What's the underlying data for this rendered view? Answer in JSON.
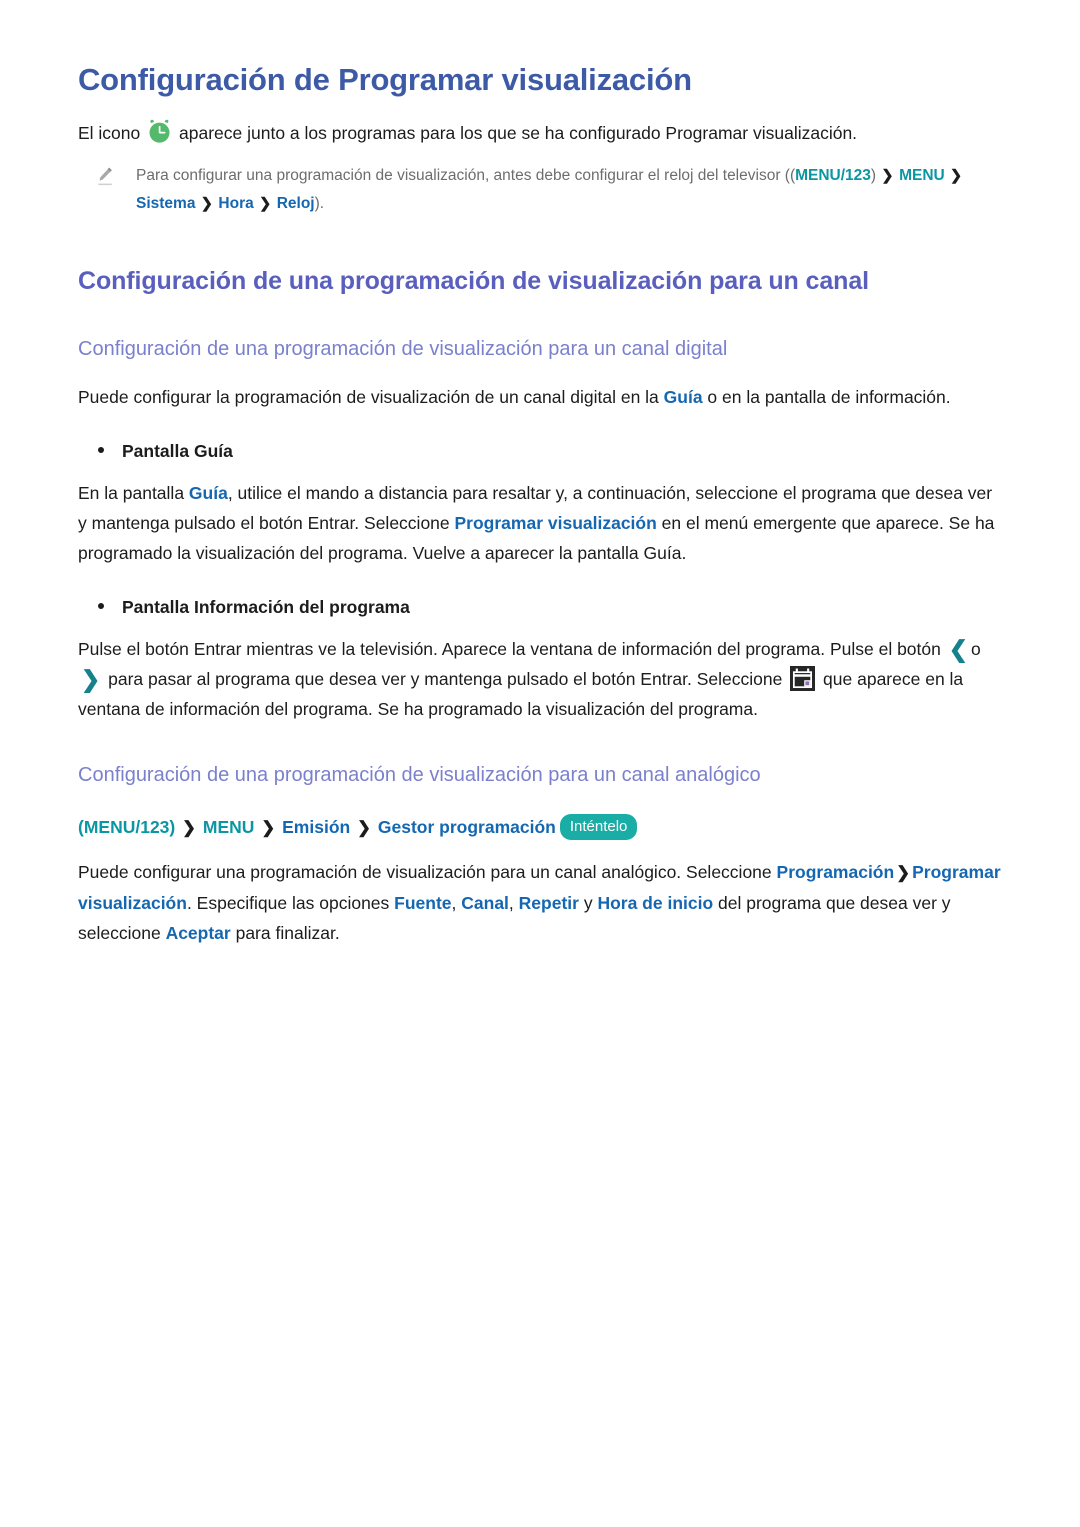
{
  "document": {
    "title": "Configuración de Programar visualización",
    "intro": {
      "before_icon": "El icono",
      "icon": "alarm-clock-icon",
      "after_icon": "aparece junto a los programas para los que se ha configurado Programar visualización."
    },
    "note": {
      "icon": "pencil-icon",
      "text_1": "Para configurar una programación de visualización, antes debe configurar el reloj del televisor ((",
      "kw_menu123": "MENU/123",
      "text_2": ")",
      "chevron": "❯",
      "kw_menu": "MENU",
      "kw_sistema": "Sistema",
      "kw_hora": "Hora",
      "kw_reloj": "Reloj",
      "text_end": ")."
    },
    "section_channel": {
      "heading": "Configuración de una programación de visualización para un canal",
      "digital": {
        "heading": "Configuración de una programación de visualización para un canal digital",
        "intro_1": "Puede configurar la programación de visualización de un canal digital en la ",
        "intro_kw": "Guía",
        "intro_2": " o en la pantalla de información.",
        "bullets": [
          {
            "label": "Pantalla Guía",
            "body_1": "En la pantalla ",
            "body_kw_1": "Guía",
            "body_2": ", utilice el mando a distancia para resaltar y, a continuación, seleccione el programa que desea ver y mantenga pulsado el botón Entrar. Seleccione ",
            "body_kw_2": "Programar visualización",
            "body_3": " en el menú emergente que aparece. Se ha programado la visualización del programa. Vuelve a aparecer la pantalla Guía."
          },
          {
            "label": "Pantalla Información del programa",
            "body_1": "Pulse el botón Entrar mientras ve la televisión. Aparece la ventana de información del programa. Pulse el botón ",
            "arrow_left": "❮",
            "arrow_sep": "o",
            "arrow_right": "❯",
            "body_2": " para pasar al programa que desea ver y mantenga pulsado el botón Entrar. Seleccione ",
            "inline_icon": "schedule-calendar-icon",
            "body_3": " que aparece en la ventana de información del programa. Se ha programado la visualización del programa."
          }
        ]
      },
      "analog": {
        "heading": "Configuración de una programación de visualización para un canal analógico",
        "breadcrumb": {
          "open_paren": "(",
          "kw_menu123": "MENU/123",
          "close_paren": ")",
          "chevron": "❯",
          "kw_menu": "MENU",
          "kw_emision": "Emisión",
          "kw_gestor": "Gestor programación",
          "try_badge": "Inténtelo"
        },
        "body_1": "Puede configurar una programación de visualización para un canal analógico. Seleccione ",
        "kw_programacion": "Programación",
        "chevron": "❯",
        "kw_programar_vis": "Programar visualización",
        "body_2": ". Especifique las opciones ",
        "kw_fuente": "Fuente",
        "comma_1": ", ",
        "kw_canal": "Canal",
        "comma_2": ", ",
        "kw_repetir": "Repetir",
        "conj": " y ",
        "kw_hora_inicio": "Hora de inicio",
        "body_3": " del programa que desea ver y seleccione ",
        "kw_aceptar": "Aceptar",
        "body_4": " para finalizar."
      }
    },
    "colors": {
      "title": "#3d5aa6",
      "section_heading": "#5a5fbe",
      "sub_heading": "#7b80cd",
      "keyword_blue": "#1567b2",
      "keyword_teal": "#0b96a3",
      "try_badge_bg": "#1aada6",
      "clock_icon": "#54b96b",
      "note_text": "#6d6d6d"
    }
  }
}
